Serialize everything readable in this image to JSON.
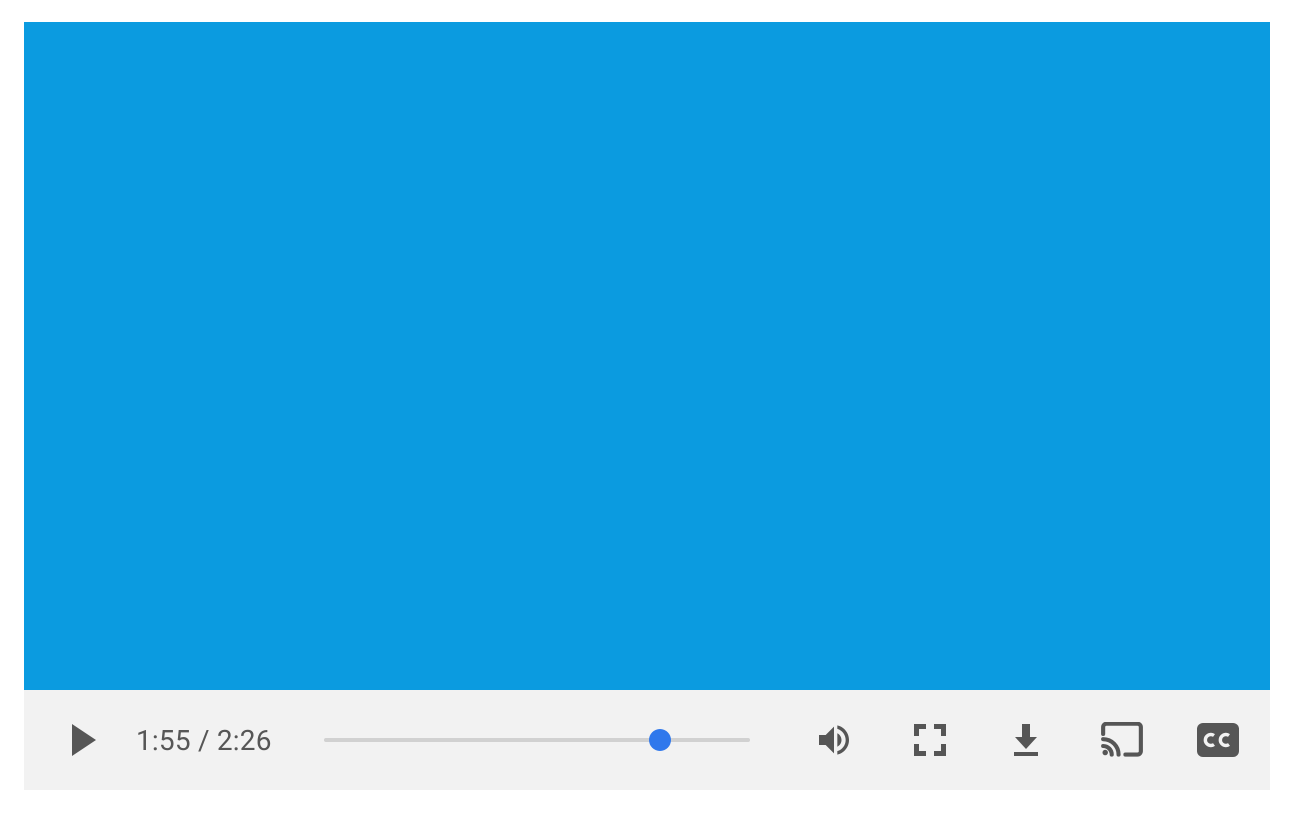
{
  "player": {
    "current_time": "1:55",
    "duration": "2:26",
    "time_separator": " / ",
    "progress_percent": 79,
    "colors": {
      "video_bg": "#0b9be0",
      "control_bg": "#f2f2f2",
      "icon": "#565656",
      "thumb": "#2f78ec",
      "track": "#d1d1d1"
    },
    "icons": {
      "play": "play-icon",
      "volume": "volume-icon",
      "fullscreen": "fullscreen-icon",
      "download": "download-icon",
      "cast": "cast-icon",
      "captions": "captions-icon"
    }
  }
}
